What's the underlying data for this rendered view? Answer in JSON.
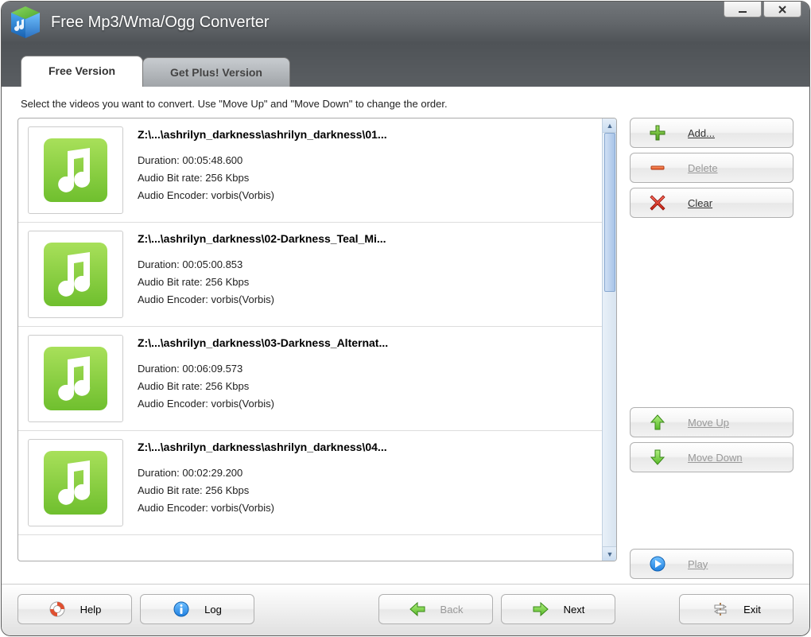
{
  "window": {
    "title": "Free Mp3/Wma/Ogg Converter"
  },
  "tabs": [
    {
      "label": "Free Version",
      "active": true
    },
    {
      "label": "Get Plus! Version",
      "active": false
    }
  ],
  "instruction": "Select the videos you want to convert. Use \"Move Up\" and \"Move Down\" to change the order.",
  "items": [
    {
      "title": "Z:\\...\\ashrilyn_darkness\\ashrilyn_darkness\\01...",
      "duration": "Duration: 00:05:48.600",
      "bitrate": "Audio Bit rate: 256 Kbps",
      "encoder": "Audio Encoder: vorbis(Vorbis)"
    },
    {
      "title": "Z:\\...\\ashrilyn_darkness\\02-Darkness_Teal_Mi...",
      "duration": "Duration: 00:05:00.853",
      "bitrate": "Audio Bit rate: 256 Kbps",
      "encoder": "Audio Encoder: vorbis(Vorbis)"
    },
    {
      "title": "Z:\\...\\ashrilyn_darkness\\03-Darkness_Alternat...",
      "duration": "Duration: 00:06:09.573",
      "bitrate": "Audio Bit rate: 256 Kbps",
      "encoder": "Audio Encoder: vorbis(Vorbis)"
    },
    {
      "title": "Z:\\...\\ashrilyn_darkness\\ashrilyn_darkness\\04...",
      "duration": "Duration: 00:02:29.200",
      "bitrate": "Audio Bit rate: 256 Kbps",
      "encoder": "Audio Encoder: vorbis(Vorbis)"
    }
  ],
  "side_buttons": {
    "add": "Add...",
    "delete": "Delete",
    "clear": "Clear",
    "move_up": "Move Up",
    "move_down": "Move Down",
    "play": "Play"
  },
  "bottom": {
    "help": "Help",
    "log": "Log",
    "back": "Back",
    "next": "Next",
    "exit": "Exit"
  }
}
